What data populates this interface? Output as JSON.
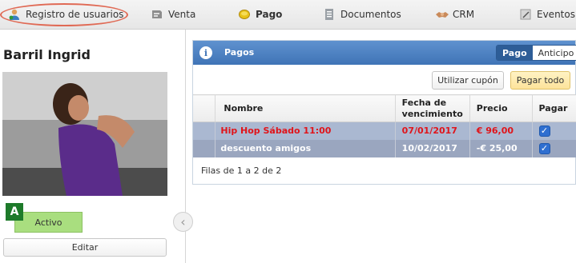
{
  "toolbar": {
    "tabs": [
      {
        "label": "Registro de usuarios",
        "icon": "user-register-icon"
      },
      {
        "label": "Venta",
        "icon": "sale-icon"
      },
      {
        "label": "Pago",
        "icon": "coin-icon"
      },
      {
        "label": "Documentos",
        "icon": "document-icon"
      },
      {
        "label": "CRM",
        "icon": "handshake-icon"
      },
      {
        "label": "Eventos re",
        "icon": "event-icon"
      }
    ],
    "highlight_color": "#e06a55"
  },
  "profile": {
    "name": "Barril Ingrid",
    "badge": "A",
    "status": "Activo",
    "edit_label": "Editar",
    "collapse_glyph": "‹"
  },
  "payments": {
    "title": "Pagos",
    "info_glyph": "i",
    "segments": [
      "Pago",
      "Anticipo"
    ],
    "coupon_button": "Utilizar cupón",
    "pay_all_button": "Pagar todo",
    "columns": [
      "Nombre",
      "Fecha de vencimiento",
      "Precio",
      "Pagar"
    ],
    "rows": [
      {
        "nombre": "Hip Hop Sábado 11:00",
        "fecha": "07/01/2017",
        "precio": "€ 96,00",
        "pagar": true
      },
      {
        "nombre": "descuento amigos",
        "fecha": "10/02/2017",
        "precio": "-€ 25,00",
        "pagar": true
      }
    ],
    "footer": "Filas de 1 a 2 de 2"
  }
}
